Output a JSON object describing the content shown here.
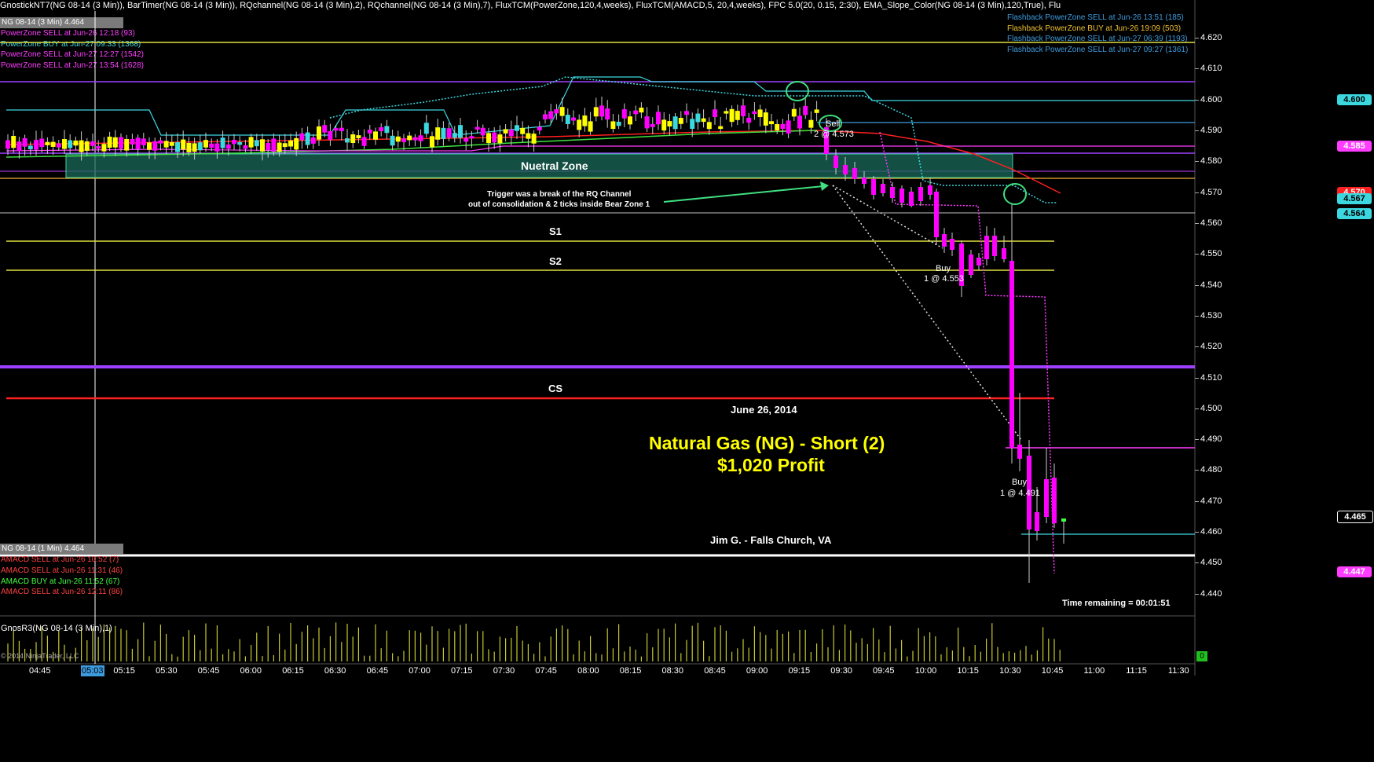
{
  "header": {
    "indicators": "GnostickNT7(NG 08-14 (3 Min)), BarTimer(NG 08-14 (3 Min)), RQchannel(NG 08-14 (3 Min),2), RQchannel(NG 08-14 (3 Min),7), FluxTCM(PowerZone,120,4,weeks), FluxTCM(AMACD,5, 20,4,weeks), FPC 5.0(20, 0.15, 2:30), EMA_Slope_Color(NG 08-14 (3 Min),120,True), Flu"
  },
  "top_panel": {
    "instrument_box": "NG 08-14 (3 Min) 4.464",
    "left_signals": [
      {
        "text": "PowerZone SELL at Jun-26 12:18 (93)",
        "color": "#ff3cff"
      },
      {
        "text": "PowerZone BUY at Jun-27 09:33 (1368)",
        "color": "#3cd8e0"
      },
      {
        "text": "PowerZone SELL at Jun-27 12:27 (1542)",
        "color": "#ff3cff"
      },
      {
        "text": "PowerZone SELL at Jun-27 13:54 (1628)",
        "color": "#ff3cff"
      }
    ],
    "right_signals": [
      {
        "text": "Flashback PowerZone SELL at Jun-26 13:51 (185)",
        "color": "#3c9ce0"
      },
      {
        "text": "Flashback PowerZone BUY at Jun-26 19:09 (503)",
        "color": "#f0c030"
      },
      {
        "text": "Flashback PowerZone SELL at Jun-27 06:39 (1193)",
        "color": "#3c9ce0"
      },
      {
        "text": "Flashback PowerZone SELL at Jun-27 09:27 (1361)",
        "color": "#3c9ce0"
      }
    ]
  },
  "annotations": {
    "neutral_zone": "Nuetral Zone",
    "trigger_line1": "Trigger was a break of the RQ Channel",
    "trigger_line2": "out of consolidation & 2 ticks inside Bear Zone 1",
    "s1": "S1",
    "s2": "S2",
    "cs": "CS",
    "date": "June 26, 2014",
    "title_line1": "Natural Gas (NG) - Short (2)",
    "title_line2": "$1,020 Profit",
    "author": "Jim G. - Falls Church, VA",
    "sell_label": "Sell",
    "sell_detail": "2 @ 4.573",
    "buy1_label": "Buy",
    "buy1_detail": "1 @ 4.553",
    "buy2_label": "Buy",
    "buy2_detail": "1 @ 4.491",
    "time_remaining": "Time remaining = 00:01:51"
  },
  "amacd_panel": {
    "instrument_box": "NG 08-14 (1 Min) 4.464",
    "signals": [
      {
        "text": "AMACD SELL at Jun-26 10:52 (7)",
        "color": "#ff4040"
      },
      {
        "text": "AMACD SELL at Jun-26 11:31 (46)",
        "color": "#ff4040"
      },
      {
        "text": "AMACD BUY at Jun-26 11:52 (67)",
        "color": "#40ff40"
      },
      {
        "text": "AMACD SELL at Jun-26 12:11 (86)",
        "color": "#ff4040"
      }
    ]
  },
  "volume_panel": {
    "label": "GnosR3(NG 08-14 (3 Min),1)",
    "copyright": "© 2014 NinjaTrader, LLC",
    "right_value": "0"
  },
  "price_axis": {
    "ticks": [
      "4.620",
      "4.610",
      "4.600",
      "4.590",
      "4.580",
      "4.570",
      "4.560",
      "4.550",
      "4.540",
      "4.530",
      "4.520",
      "4.510",
      "4.500",
      "4.490",
      "4.480",
      "4.470",
      "4.460",
      "4.450",
      "4.440"
    ],
    "tags": [
      {
        "value": "4.600",
        "bg": "#3cd8e0",
        "fg": "#000"
      },
      {
        "value": "4.585",
        "bg": "#ff3cff",
        "fg": "#fff"
      },
      {
        "value": "4.570",
        "bg": "#ff2020",
        "fg": "#fff"
      },
      {
        "value": "4.567",
        "bg": "#3cd8e0",
        "fg": "#000"
      },
      {
        "value": "4.564",
        "bg": "#3cd8e0",
        "fg": "#000"
      },
      {
        "value": "4.465",
        "bg": "#000",
        "fg": "#fff"
      },
      {
        "value": "4.447",
        "bg": "#ff3cff",
        "fg": "#fff"
      }
    ]
  },
  "time_axis": {
    "labels": [
      "04:45",
      "05:03",
      "05:15",
      "05:30",
      "05:45",
      "06:00",
      "06:15",
      "06:30",
      "06:45",
      "07:00",
      "07:15",
      "07:30",
      "07:45",
      "08:00",
      "08:15",
      "08:30",
      "08:45",
      "09:00",
      "09:15",
      "09:30",
      "09:45",
      "10:00",
      "10:15",
      "10:30",
      "10:45",
      "11:00",
      "11:15",
      "11:30"
    ],
    "highlight": "05:03"
  },
  "colors": {
    "bull": "#ffff00",
    "bear": "#ff00ff",
    "cyan": "#3cd8e0",
    "s_lines": "#e0e040",
    "cs_line": "#ff2020",
    "zone_line": "#a040ff"
  }
}
